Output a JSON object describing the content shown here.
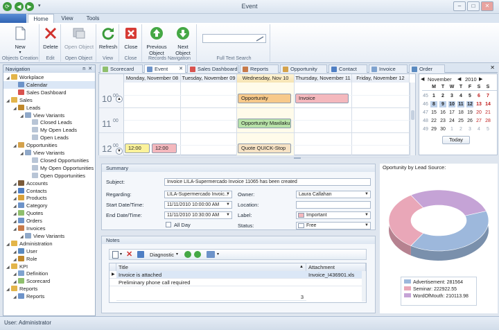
{
  "window": {
    "title": "Event"
  },
  "ribbon_tabs": [
    "Home",
    "View",
    "Tools"
  ],
  "ribbon": {
    "groups": [
      {
        "label": "Objects Creation",
        "buttons": [
          {
            "label": "New",
            "icon": "new-document-icon",
            "enabled": true
          }
        ]
      },
      {
        "label": "Edit",
        "buttons": [
          {
            "label": "Delete",
            "icon": "delete-x-icon",
            "enabled": true
          }
        ]
      },
      {
        "label": "Open Object",
        "buttons": [
          {
            "label": "Open Object",
            "icon": "open-object-icon",
            "enabled": false
          }
        ]
      },
      {
        "label": "View",
        "buttons": [
          {
            "label": "Refresh",
            "icon": "refresh-icon",
            "enabled": true
          }
        ]
      },
      {
        "label": "Close",
        "buttons": [
          {
            "label": "Close",
            "icon": "close-red-icon",
            "enabled": true
          }
        ]
      },
      {
        "label": "Records Navigation",
        "buttons": [
          {
            "label": "Previous Object",
            "icon": "arrow-up-icon",
            "enabled": true
          },
          {
            "label": "Next Object",
            "icon": "arrow-down-icon",
            "enabled": true
          }
        ]
      },
      {
        "label": "Full Text Search",
        "buttons": []
      }
    ]
  },
  "navigation": {
    "title": "Navigation",
    "items": [
      {
        "label": "Workplace",
        "level": 0,
        "icon": "folder-icon"
      },
      {
        "label": "Calendar",
        "level": 1,
        "icon": "calendar-icon",
        "selected": true
      },
      {
        "label": "Sales Dashboard",
        "level": 1,
        "icon": "dashboard-icon"
      },
      {
        "label": "Sales",
        "level": 0,
        "icon": "folder-icon"
      },
      {
        "label": "Leads",
        "level": 1,
        "icon": "leads-icon"
      },
      {
        "label": "View Variants",
        "level": 2,
        "icon": "view-variants-icon"
      },
      {
        "label": "Closed Leads",
        "level": 3,
        "icon": "list-icon"
      },
      {
        "label": "My Open Leads",
        "level": 3,
        "icon": "list-icon"
      },
      {
        "label": "Open Leads",
        "level": 3,
        "icon": "list-icon"
      },
      {
        "label": "Opportunities",
        "level": 1,
        "icon": "opportunities-icon"
      },
      {
        "label": "View Variants",
        "level": 2,
        "icon": "view-variants-icon"
      },
      {
        "label": "Closed Opportunities",
        "level": 3,
        "icon": "list-icon"
      },
      {
        "label": "My Open Opportunities",
        "level": 3,
        "icon": "list-icon"
      },
      {
        "label": "Open Opportunities",
        "level": 3,
        "icon": "list-icon"
      },
      {
        "label": "Accounts",
        "level": 1,
        "icon": "accounts-icon"
      },
      {
        "label": "Contacts",
        "level": 1,
        "icon": "contacts-icon"
      },
      {
        "label": "Products",
        "level": 1,
        "icon": "products-icon"
      },
      {
        "label": "Category",
        "level": 1,
        "icon": "category-icon"
      },
      {
        "label": "Quotes",
        "level": 1,
        "icon": "quotes-icon"
      },
      {
        "label": "Orders",
        "level": 1,
        "icon": "orders-icon"
      },
      {
        "label": "Invoices",
        "level": 1,
        "icon": "invoices-icon"
      },
      {
        "label": "View Variants",
        "level": 2,
        "icon": "view-variants-icon"
      },
      {
        "label": "Administration",
        "level": 0,
        "icon": "folder-icon"
      },
      {
        "label": "User",
        "level": 1,
        "icon": "user-icon"
      },
      {
        "label": "Role",
        "level": 1,
        "icon": "role-icon"
      },
      {
        "label": "KPI",
        "level": 0,
        "icon": "folder-icon"
      },
      {
        "label": "Definition",
        "level": 1,
        "icon": "definition-icon"
      },
      {
        "label": "Scorecard",
        "level": 1,
        "icon": "scorecard-icon"
      },
      {
        "label": "Reports",
        "level": 0,
        "icon": "folder-icon"
      },
      {
        "label": "Reports",
        "level": 1,
        "icon": "reports-icon"
      }
    ]
  },
  "doc_tabs": [
    {
      "label": "Scorecard",
      "active": false
    },
    {
      "label": "Event",
      "active": true
    },
    {
      "label": "Sales Dashboard",
      "active": false
    },
    {
      "label": "Reports",
      "active": false
    },
    {
      "label": "Opportunity",
      "active": false
    },
    {
      "label": "Contact",
      "active": false
    },
    {
      "label": "Invoice",
      "active": false
    },
    {
      "label": "Order",
      "active": false
    }
  ],
  "scheduler": {
    "days": [
      "Monday, November 08",
      "Tuesday, November 09",
      "Wednesday, Nov 10",
      "Thursday, November 11",
      "Friday, November 12"
    ],
    "hours": [
      "10",
      "11",
      "12"
    ],
    "hour_suffix": "00",
    "appointments": [
      {
        "label": "Opportunity",
        "day": 2,
        "slot": 0,
        "color": "#f7c98a"
      },
      {
        "label": "Invoice",
        "day": 3,
        "slot": 0,
        "color": "#f4b8bd"
      },
      {
        "label": "Opportunity Maxilaku",
        "day": 2,
        "slot": 1,
        "color": "#b8e3a8"
      },
      {
        "label": "Quote QUICK-Stop",
        "day": 2,
        "slot": 2,
        "color": "#f6e2c4"
      },
      {
        "label": "12:00",
        "day": 0,
        "slot": 2,
        "color": "#fbf29a"
      },
      {
        "label": "12:00",
        "day": 0.5,
        "slot": 2,
        "color": "#f4b8bd"
      }
    ]
  },
  "mini_calendar": {
    "month": "November",
    "year": "2010",
    "weekdays": [
      "M",
      "T",
      "W",
      "T",
      "F",
      "S",
      "S"
    ],
    "weeks": [
      {
        "wk": "45",
        "days": [
          "1",
          "2",
          "3",
          "4",
          "5",
          "6",
          "7"
        ]
      },
      {
        "wk": "46",
        "days": [
          "8",
          "9",
          "10",
          "11",
          "12",
          "13",
          "14"
        ]
      },
      {
        "wk": "47",
        "days": [
          "15",
          "16",
          "17",
          "18",
          "19",
          "20",
          "21"
        ]
      },
      {
        "wk": "48",
        "days": [
          "22",
          "23",
          "24",
          "25",
          "26",
          "27",
          "28"
        ]
      },
      {
        "wk": "49",
        "days": [
          "29",
          "30",
          "1",
          "2",
          "3",
          "4",
          "5"
        ]
      }
    ],
    "today_label": "Today"
  },
  "summary": {
    "title": "Summary",
    "subject_label": "Subject:",
    "subject": "Invoice LILA-Supermercado Invoice 11065 has been created",
    "regarding_label": "Regarding:",
    "regarding": "LILA-Supermercado Invoic...",
    "owner_label": "Owner:",
    "owner": "Laura Callahan",
    "start_label": "Start Date/Time:",
    "start": "11/11/2010 10:00:00 AM",
    "location_label": "Location:",
    "location": "",
    "end_label": "End Date/Time:",
    "end": "11/11/2010 10:30:00 AM",
    "label_label": "Label:",
    "label_value": "Important",
    "label_color": "#f4b8bd",
    "allday_label": "All Day",
    "status_label": "Status:",
    "status_value": "Free"
  },
  "notes": {
    "title": "Notes",
    "diagnostic": "Diagnostic",
    "columns": [
      "Title",
      "Attachment"
    ],
    "rows": [
      {
        "title": "Invoice is attached",
        "attachment": "Invoice_I436901.xls"
      },
      {
        "title": "Preliminary phone call required",
        "attachment": ""
      }
    ],
    "count": "3"
  },
  "chart": {
    "title": "Oportunity by Lead Source:",
    "legend": [
      "Advertisement: 281564",
      "Seminar: 222922.55",
      "WordOfMouth: 210113.98"
    ]
  },
  "chart_data": {
    "type": "pie",
    "title": "Oportunity by Lead Source:",
    "categories": [
      "Advertisement",
      "Seminar",
      "WordOfMouth"
    ],
    "values": [
      281564,
      222922.55,
      210113.98
    ],
    "colors": [
      "#9db8dc",
      "#e9a7b8",
      "#c5a3d6"
    ]
  },
  "status_bar": {
    "user": "User: Administrator"
  }
}
